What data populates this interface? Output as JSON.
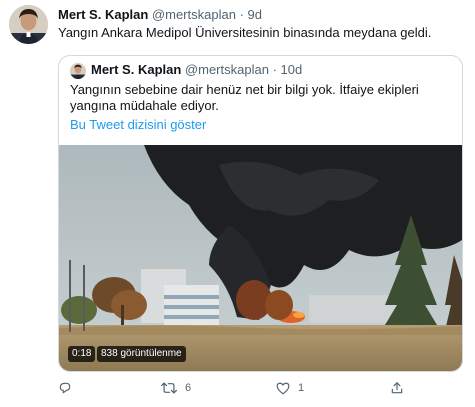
{
  "tweet": {
    "author_name": "Mert S. Kaplan",
    "author_handle": "@mertskaplan",
    "time_ago": "9d",
    "text": "Yangın Ankara Medipol Üniversitesinin binasında meydana geldi.",
    "separator": "·"
  },
  "quoted": {
    "author_name": "Mert S. Kaplan",
    "author_handle": "@mertskaplan",
    "time_ago": "10d",
    "text_line1": "Yangının sebebine dair henüz net bir bilgi yok. İtfaiye ekipleri",
    "text_line2": "yangına müdahale ediyor.",
    "thread_link": "Bu Tweet dizisini göster",
    "video": {
      "duration": "0:18",
      "views": "838 görüntülenme"
    }
  },
  "actions": {
    "reply_icon": "reply-icon",
    "retweet_icon": "retweet-icon",
    "retweet_count": "6",
    "like_icon": "heart-icon",
    "like_count": "1",
    "share_icon": "share-icon"
  },
  "colors": {
    "link": "#1d9bf0",
    "secondary_text": "#536471",
    "border": "#cfd9de"
  }
}
